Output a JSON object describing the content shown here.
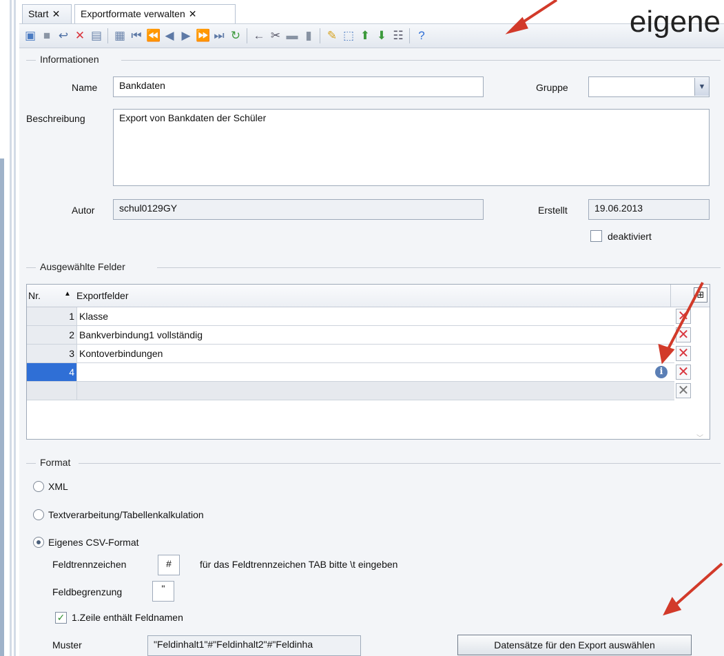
{
  "tabs": [
    {
      "label": "Start",
      "close": "✕"
    },
    {
      "label": "Exportformate verwalten",
      "close": "✕"
    }
  ],
  "callout_text": "eigene",
  "toolbar": {
    "icons": [
      "new-icon",
      "save-icon",
      "undo-icon",
      "delete-icon",
      "properties-icon",
      "list-icon",
      "first-icon",
      "prev-page-icon",
      "prev-icon",
      "next-icon",
      "next-page-icon",
      "last-icon",
      "refresh-icon",
      "back-icon",
      "cut-icon",
      "copy-icon",
      "paste-icon",
      "clear-icon",
      "select-icon",
      "import-icon",
      "export-icon",
      "structure-icon",
      "help-icon"
    ]
  },
  "informationen": {
    "title": "Informationen",
    "name_label": "Name",
    "name_value": "Bankdaten",
    "gruppe_label": "Gruppe",
    "gruppe_value": "",
    "beschreibung_label": "Beschreibung",
    "beschreibung_value": "Export von Bankdaten der Schüler",
    "autor_label": "Autor",
    "autor_value": "schul0129GY",
    "erstellt_label": "Erstellt",
    "erstellt_value": "19.06.2013",
    "deaktiviert_label": "deaktiviert",
    "deaktiviert_checked": false
  },
  "felder": {
    "title": "Ausgewählte Felder",
    "col_nr": "Nr.",
    "col_export": "Exportfelder",
    "rows": [
      {
        "nr": "1",
        "value": "Klasse"
      },
      {
        "nr": "2",
        "value": "Bankverbindung1 vollständig"
      },
      {
        "nr": "3",
        "value": "Kontoverbindungen"
      },
      {
        "nr": "4",
        "value": ""
      }
    ],
    "delete_glyph": "✕",
    "info_glyph": "i"
  },
  "format": {
    "title": "Format",
    "options": [
      "XML",
      "Textverarbeitung/Tabellenkalkulation",
      "Eigenes CSV-Format"
    ],
    "selected": "Eigenes CSV-Format",
    "feldtrenn_label": "Feldtrennzeichen",
    "feldtrenn_value": "#",
    "feldtrenn_hint": "für das Feldtrennzeichen TAB bitte \\t eingeben",
    "feldbegrenzung_label": "Feldbegrenzung",
    "feldbegrenzung_value": "\"",
    "zeile1_label": "1.Zeile enthält Feldnamen",
    "zeile1_checked": true,
    "muster_label": "Muster",
    "muster_value": "\"Feldinhalt1\"#\"Feldinhalt2\"#\"Feldinha",
    "export_button": "Datensätze für den Export auswählen"
  },
  "colors": {
    "arrow": "#d23a2a",
    "accent": "#2f6fd6"
  }
}
